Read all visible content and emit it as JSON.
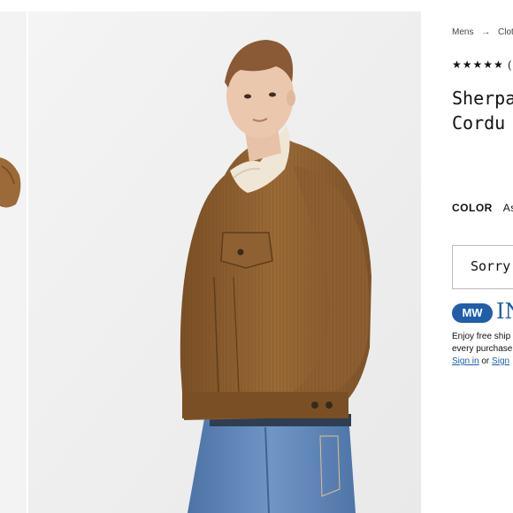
{
  "breadcrumb": {
    "items": [
      "Mens",
      "→",
      "Cloth"
    ]
  },
  "product": {
    "rating_stars": "★★★★★",
    "rating_count": "(",
    "title_line1": "Sherpa",
    "title_line2": "Cordu",
    "color_label": "COLOR",
    "color_value": "As",
    "availability": "Sorry"
  },
  "insider": {
    "badge": "MW",
    "program": "IN",
    "promo_line1": "Enjoy free ship",
    "promo_line2": "every purchase",
    "sign_in": "Sign in",
    "or": "or",
    "sign_up": "Sign"
  },
  "colors": {
    "brand_blue": "#1f5ea8",
    "jacket": "#8a5c2e",
    "denim": "#5e86b8"
  }
}
